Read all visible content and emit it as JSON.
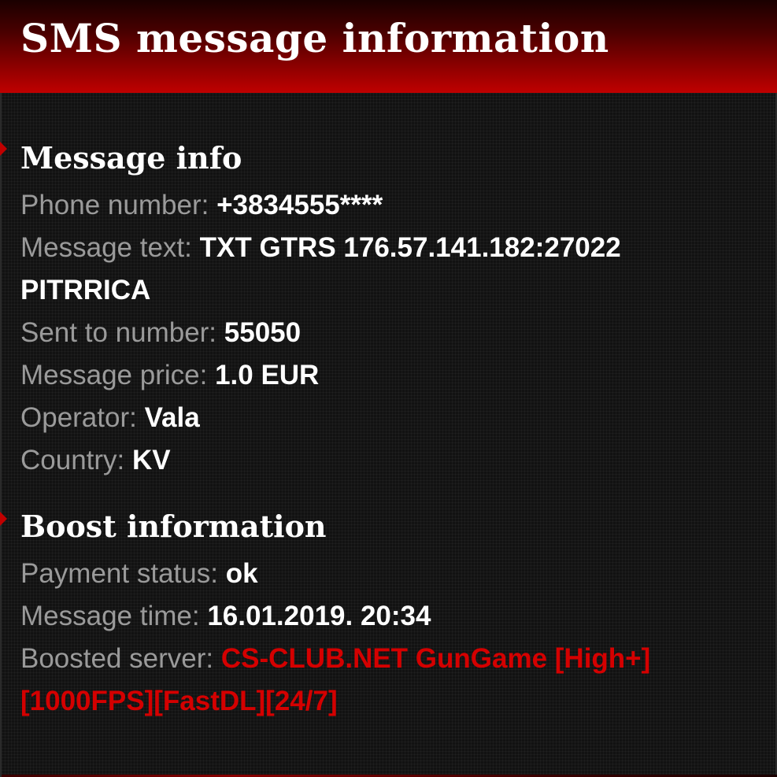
{
  "header": {
    "title": "SMS message information"
  },
  "message_info": {
    "heading": "Message info",
    "phone_label": "Phone number:",
    "phone_value": "+3834555****",
    "text_label": "Message text:",
    "text_value_line1": "TXT GTRS 176.57.141.182:27022",
    "text_value_line2": "PITRRICA",
    "sent_to_label": "Sent to number:",
    "sent_to_value": "55050",
    "price_label": "Message price:",
    "price_value": "1.0 EUR",
    "operator_label": "Operator:",
    "operator_value": "Vala",
    "country_label": "Country:",
    "country_value": "KV"
  },
  "boost_info": {
    "heading": "Boost information",
    "status_label": "Payment status:",
    "status_value": "ok",
    "time_label": "Message time:",
    "time_value": "16.01.2019. 20:34",
    "server_label": "Boosted server:",
    "server_value_line1": "CS-CLUB.NET GunGame [High+]",
    "server_value_line2": "[1000FPS][FastDL][24/7]"
  },
  "colors": {
    "accent": "#c00000",
    "link_red": "#d40000",
    "label_gray": "#9a9a9a",
    "value_white": "#ffffff",
    "background": "#121212"
  }
}
